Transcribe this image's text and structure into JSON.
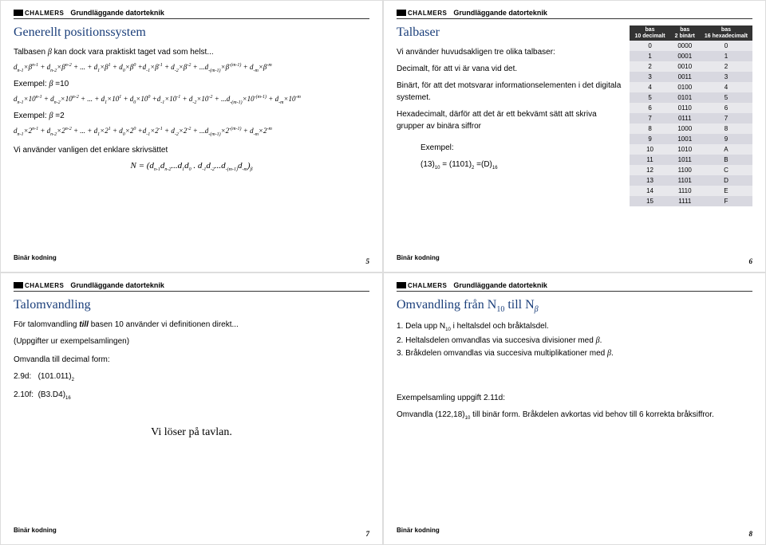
{
  "header": {
    "logo": "CHALMERS",
    "title": "Grundläggande datorteknik"
  },
  "footer": {
    "label": "Binär kodning"
  },
  "slides": [
    {
      "pageNum": "5",
      "title": "Generellt positionssystem",
      "intro": "Talbasen β kan dock vara praktiskt taget vad som helst...",
      "formula1": "dₙ₋₁×βⁿ⁻¹ + dₙ₋₂×βⁿ⁻² + ... + d₁×β¹ + d₀×β⁰ + d₋₁×β⁻¹ + d₋₂×β⁻² + ... d₋(ₘ₋₁)×β⁻(ᵐ⁻¹) + d₋ₘ×β⁻ᵐ",
      "ex1label": "Exempel: β =10",
      "formula2": "dₙ₋₁×10ⁿ⁻¹ + dₙ₋₂×10ⁿ⁻² + ... + d₁×10¹ + d₀×10⁰ + d₋₁×10⁻¹ + d₋₂×10⁻² + ... d₋(ₘ₋₁)×10⁻(ᵐ⁻¹) + d₋ₘ×10⁻ᵐ",
      "ex2label": "Exempel: β =2",
      "formula3": "dₙ₋₁×2ⁿ⁻¹ + dₙ₋₂×2ⁿ⁻² + ... + d₁×2¹ + d₀×2⁰ + d₋₁×2⁻¹ + d₋₂×2⁻² + ... d₋(ₘ₋₁)×2⁻(ᵐ⁻¹) + d₋ₘ×2⁻ᵐ",
      "closing": "Vi använder vanligen det enklare skrivsättet",
      "closingFormula": "N = (dₙ₋₁dₙ₋₂...d₁d₀ . d₋₁d₋₂...d₋(ₘ₋₁)d₋ₘ)β"
    },
    {
      "pageNum": "6",
      "title": "Talbaser",
      "p1": "Vi använder huvudsakligen tre olika talbaser:",
      "p2": "Decimalt, för att vi är vana vid det.",
      "p3": "Binärt, för att det motsvarar informationselementen i det digitala systemet.",
      "p4": "Hexadecimalt, därför att det är ett bekvämt sätt att skriva grupper av binära siffror",
      "exLabel": "Exempel:",
      "exFormula": "(13)₁₀ = (1101)₂ =(D)₁₆",
      "tableHeaders": [
        "bas 10 decimalt",
        "bas 2 binärt",
        "bas 16 hexadecimalt"
      ],
      "tableRows": [
        [
          "0",
          "0000",
          "0"
        ],
        [
          "1",
          "0001",
          "1"
        ],
        [
          "2",
          "0010",
          "2"
        ],
        [
          "3",
          "0011",
          "3"
        ],
        [
          "4",
          "0100",
          "4"
        ],
        [
          "5",
          "0101",
          "5"
        ],
        [
          "6",
          "0110",
          "6"
        ],
        [
          "7",
          "0111",
          "7"
        ],
        [
          "8",
          "1000",
          "8"
        ],
        [
          "9",
          "1001",
          "9"
        ],
        [
          "10",
          "1010",
          "A"
        ],
        [
          "11",
          "1011",
          "B"
        ],
        [
          "12",
          "1100",
          "C"
        ],
        [
          "13",
          "1101",
          "D"
        ],
        [
          "14",
          "1110",
          "E"
        ],
        [
          "15",
          "1111",
          "F"
        ]
      ]
    },
    {
      "pageNum": "7",
      "title": "Talomvandling",
      "p1": "För talomvandling till basen 10 använder vi definitionen direkt...",
      "p2": "(Uppgifter ur exempelsamlingen)",
      "p3": "Omvandla till decimal form:",
      "p4": "2.9d:    (101.011)₂",
      "p5": "2.10f:   (B3.D4)₁₆",
      "center": "Vi löser på tavlan."
    },
    {
      "pageNum": "8",
      "title": "Omvandling från N₁₀ till Nβ",
      "step1": "1. Dela upp N₁₀ i heltalsdel och bråktalsdel.",
      "step2": "2. Heltalsdelen omvandlas via succesiva divisioner med β.",
      "step3": "3. Bråkdelen omvandlas via succesiva multiplikationer med β.",
      "p1": "Exempelsamling uppgift 2.11d:",
      "p2": "Omvandla (122,18)₁₀ till binär form. Bråkdelen avkortas vid behov till 6 korrekta bråksiffror."
    }
  ]
}
